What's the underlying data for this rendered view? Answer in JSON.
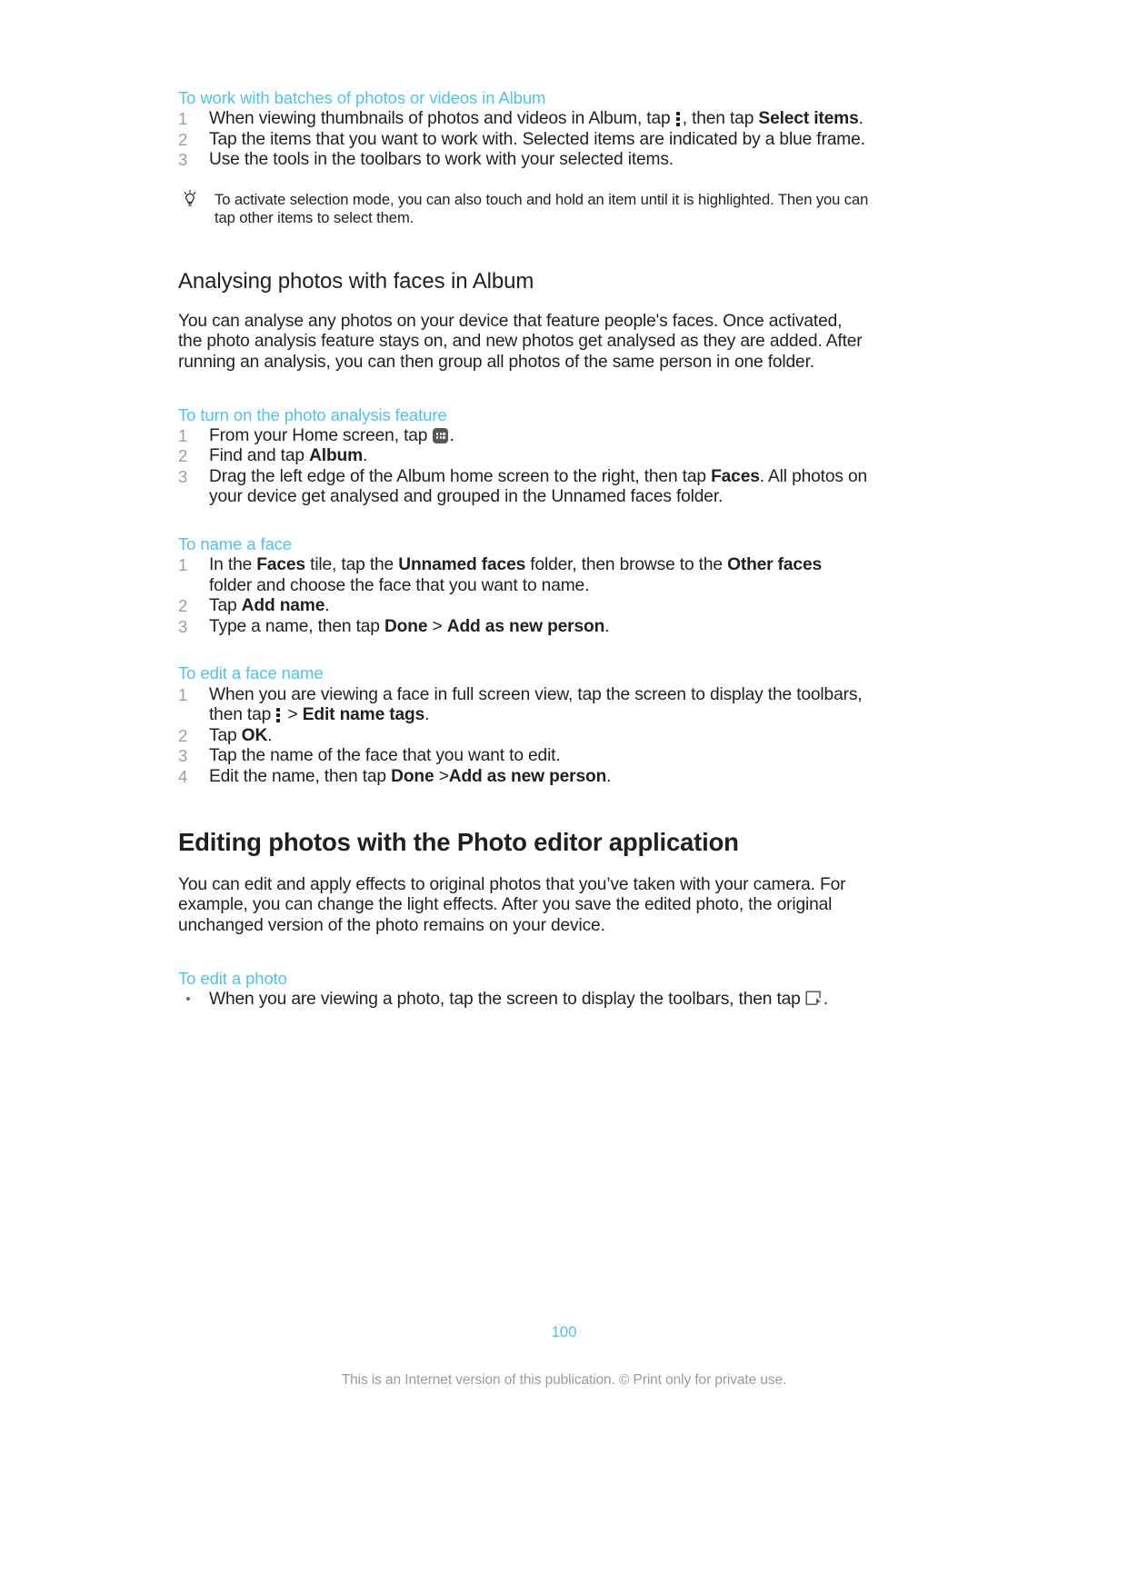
{
  "document": {
    "page_number": "100",
    "footer_note": "This is an Internet version of this publication. © Print only for private use.",
    "accent_color": "#4ec3ec",
    "text_color": "#231f20"
  },
  "sections": {
    "batches": {
      "heading": "To work with batches of photos or videos in Album",
      "steps": [
        {
          "num": "1",
          "parts": [
            {
              "type": "text",
              "text": "When viewing thumbnails of photos and videos in Album, tap "
            },
            {
              "type": "icon",
              "icon": "kebab-menu-icon"
            },
            {
              "type": "text",
              "text": ", then tap "
            },
            {
              "type": "bold",
              "text": "Select items"
            },
            {
              "type": "text",
              "text": "."
            }
          ],
          "plain": "When viewing thumbnails of photos and videos in Album, tap ⋮, then tap Select items."
        },
        {
          "num": "2",
          "plain": "Tap the items that you want to work with. Selected items are indicated by a blue frame."
        },
        {
          "num": "3",
          "plain": "Use the tools in the toolbars to work with your selected items."
        }
      ],
      "tip": "To activate selection mode, you can also touch and hold an item until it is highlighted. Then you can tap other items to select them.",
      "tip_icon": "lightbulb-tip-icon"
    },
    "analysing": {
      "heading": "Analysing photos with faces in Album",
      "body": "You can analyse any photos on your device that feature people's faces. Once activated, the photo analysis feature stays on, and new photos get analysed as they are added. After running an analysis, you can then group all photos of the same person in one folder."
    },
    "turn_on_analysis": {
      "heading": "To turn on the photo analysis feature",
      "steps": [
        {
          "num": "1",
          "plain": "From your Home screen, tap ⠿."
        },
        {
          "num": "2",
          "plain": "Find and tap Album."
        },
        {
          "num": "3",
          "plain": "Drag the left edge of the Album home screen to the right, then tap Faces. All photos on your device get analysed and grouped in the Unnamed faces folder."
        }
      ]
    },
    "name_a_face": {
      "heading": "To name a face",
      "steps": [
        {
          "num": "1",
          "plain": "In the Faces tile, tap the Unnamed faces folder, then browse to the Other faces folder and choose the face that you want to name."
        },
        {
          "num": "2",
          "plain": "Tap Add name."
        },
        {
          "num": "3",
          "plain": "Type a name, then tap Done > Add as new person."
        }
      ]
    },
    "edit_face_name": {
      "heading": "To edit a face name",
      "steps": [
        {
          "num": "1",
          "plain": "When you are viewing a face in full screen view, tap the screen to display the toolbars, then tap ⋮ > Edit name tags."
        },
        {
          "num": "2",
          "plain": "Tap OK."
        },
        {
          "num": "3",
          "plain": "Tap the name of the face that you want to edit."
        },
        {
          "num": "4",
          "plain": "Edit the name, then tap Done >Add as new person."
        }
      ]
    },
    "photo_editor": {
      "heading": "Editing photos with the Photo editor application",
      "body": "You can edit and apply effects to original photos that you’ve taken with your camera. For example, you can change the light effects. After you save the edited photo, the original unchanged version of the photo remains on your device."
    },
    "edit_a_photo": {
      "heading": "To edit a photo",
      "bullet": "When you are viewing a photo, tap the screen to display the toolbars, then tap",
      "bullet_icon": "edit-photo-icon",
      "bullet_tail": "."
    }
  },
  "fragments": {
    "t_when_viewing": "When viewing thumbnails of photos and videos in Album, tap ",
    "t_then_tap": ", then tap ",
    "b_select_items": "Select items",
    "period": ".",
    "t_step2_batches": "Tap the items that you want to work with. Selected items are indicated by a blue frame.",
    "t_step3_batches": "Use the tools in the toolbars to work with your selected items.",
    "t_from_home": "From your Home screen, tap ",
    "t_find_and_tap": "Find and tap ",
    "b_album": "Album",
    "t_drag_left": "Drag the left edge of the Album home screen to the right, then tap ",
    "b_faces": "Faces",
    "t_all_photos": ". All photos on your device get analysed and grouped in the Unnamed faces folder.",
    "t_in_the": "In the ",
    "b_faces2": "Faces",
    "t_tile_tap": " tile, tap the ",
    "b_unnamed_faces": "Unnamed faces",
    "t_folder_browse": " folder, then browse to the ",
    "b_other_faces": "Other faces",
    "t_folder_choose": " folder and choose the face that you want to name.",
    "t_tap": "Tap ",
    "b_add_name": "Add name",
    "t_type_a_name": "Type a name, then tap ",
    "b_done": "Done",
    "t_gt": " > ",
    "b_add_as_new_person": "Add as new person",
    "t_when_viewing_face": "When you are viewing a face in full screen view, tap the screen to display the toolbars, then tap ",
    "t_gt2": " > ",
    "b_edit_name_tags": "Edit name tags",
    "t_tap2": "Tap ",
    "b_ok": "OK",
    "t_tap_name_face": "Tap the name of the face that you want to edit.",
    "t_edit_the_name": "Edit the name, then tap ",
    "t_gt3": " >",
    "b_add_as_new_person2": "Add as new person"
  }
}
